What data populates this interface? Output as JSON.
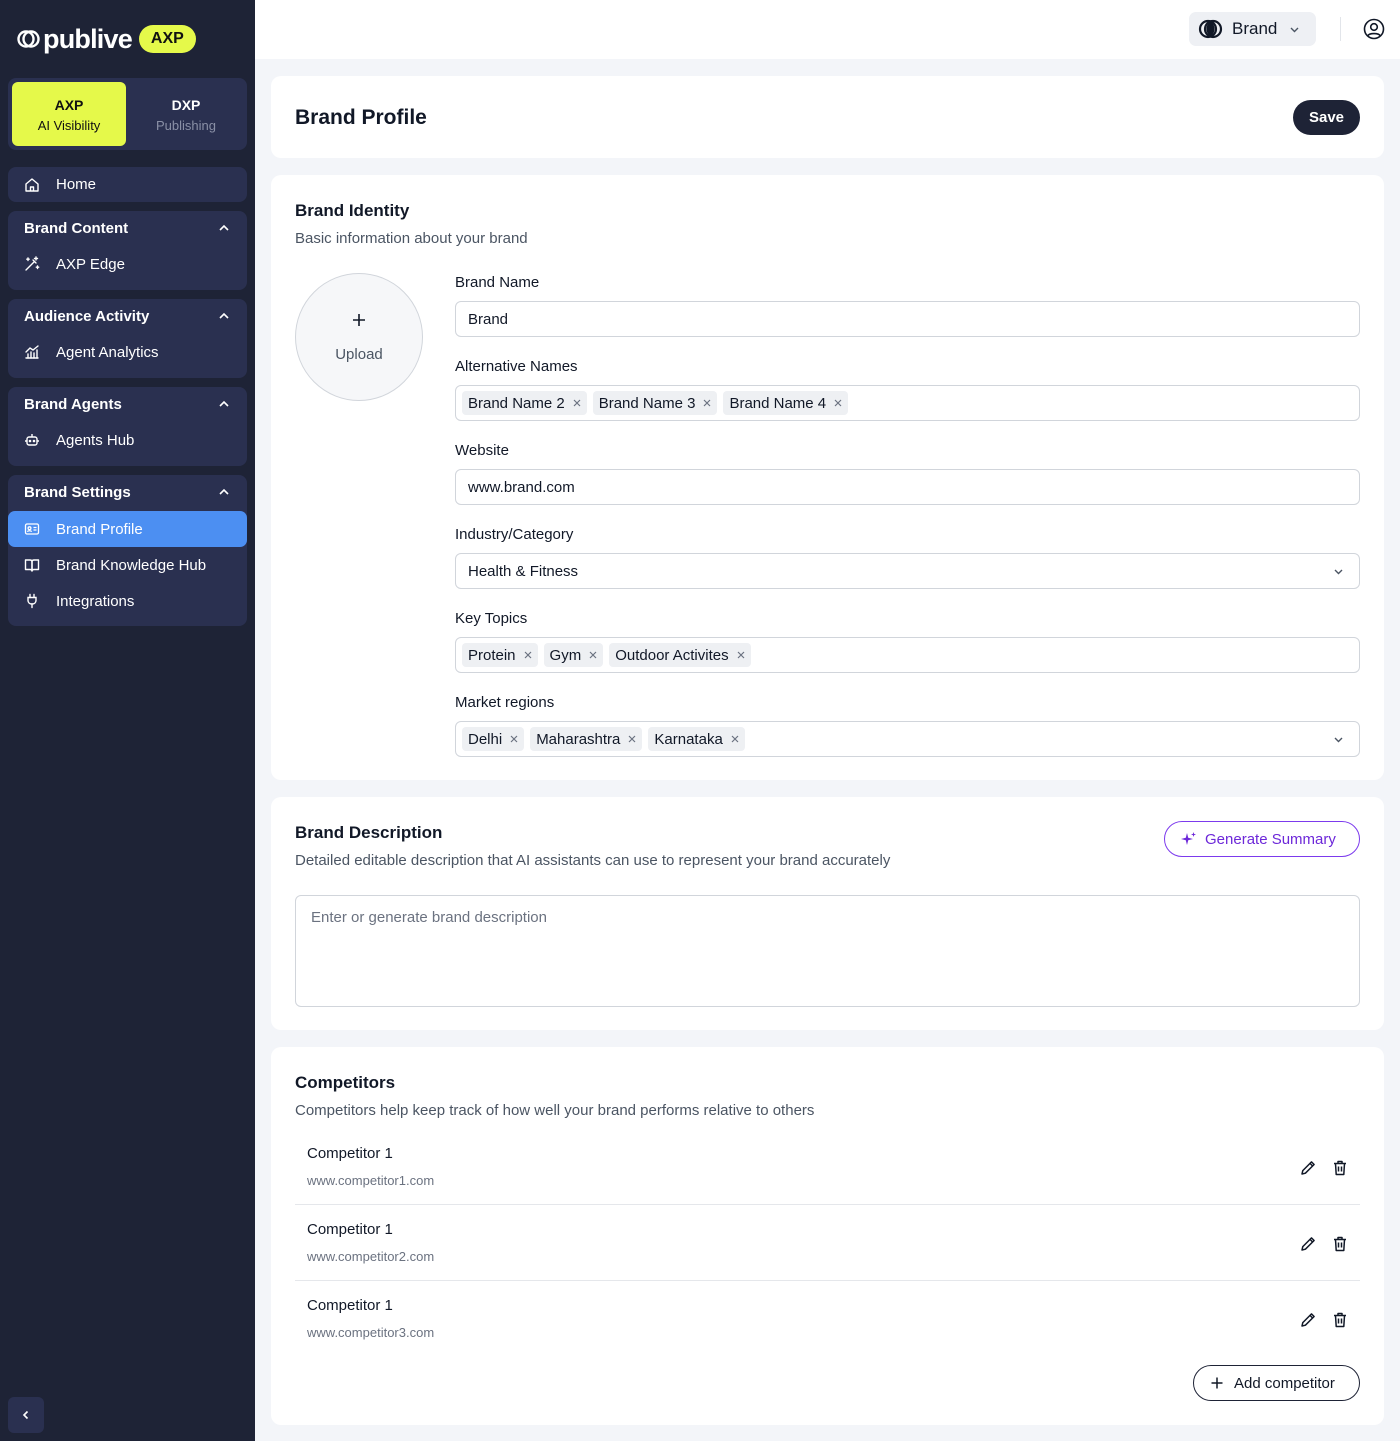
{
  "logo": {
    "name": "publive",
    "badge": "AXP"
  },
  "product_switcher": [
    {
      "title": "AXP",
      "subtitle": "AI Visibility",
      "active": true
    },
    {
      "title": "DXP",
      "subtitle": "Publishing",
      "active": false
    }
  ],
  "nav": {
    "home": "Home",
    "groups": [
      {
        "title": "Brand Content",
        "items": [
          {
            "label": "AXP Edge",
            "icon": "magic-wand-icon"
          }
        ]
      },
      {
        "title": "Audience Activity",
        "items": [
          {
            "label": "Agent Analytics",
            "icon": "analytics-chart-icon"
          }
        ]
      },
      {
        "title": "Brand Agents",
        "items": [
          {
            "label": "Agents Hub",
            "icon": "robot-icon"
          }
        ]
      },
      {
        "title": "Brand Settings",
        "items": [
          {
            "label": "Brand Profile",
            "icon": "id-card-icon",
            "active": true
          },
          {
            "label": "Brand Knowledge Hub",
            "icon": "book-icon"
          },
          {
            "label": "Integrations",
            "icon": "plug-icon"
          }
        ]
      }
    ]
  },
  "topbar": {
    "brand_selector": "Brand"
  },
  "page": {
    "title": "Brand Profile",
    "save_label": "Save"
  },
  "identity": {
    "title": "Brand Identity",
    "subtitle": "Basic information about your brand",
    "upload_label": "Upload",
    "brand_name_label": "Brand Name",
    "brand_name": "Brand",
    "alt_names_label": "Alternative Names",
    "alt_names": [
      "Brand Name 2",
      "Brand Name 3",
      "Brand Name 4"
    ],
    "website_label": "Website",
    "website": "www.brand.com",
    "industry_label": "Industry/Category",
    "industry": "Health & Fitness",
    "topics_label": "Key Topics",
    "topics": [
      "Protein",
      "Gym",
      "Outdoor Activites"
    ],
    "regions_label": "Market regions",
    "regions": [
      "Delhi",
      "Maharashtra",
      "Karnataka"
    ]
  },
  "description": {
    "title": "Brand Description",
    "subtitle": "Detailed editable description that AI assistants can use to represent your brand accurately",
    "generate_label": "Generate Summary",
    "placeholder": "Enter or generate brand description"
  },
  "competitors": {
    "title": "Competitors",
    "subtitle": "Competitors help keep track of how well your brand performs relative to others",
    "items": [
      {
        "name": "Competitor 1",
        "url": "www.competitor1.com"
      },
      {
        "name": "Competitor 1",
        "url": "www.competitor2.com"
      },
      {
        "name": "Competitor 1",
        "url": "www.competitor3.com"
      }
    ],
    "add_label": "Add competitor"
  },
  "colors": {
    "sidebar_bg": "#1e2336",
    "accent_yellow": "#e5f94a",
    "active_blue": "#4c8ff2",
    "purple": "#7c3aed"
  }
}
